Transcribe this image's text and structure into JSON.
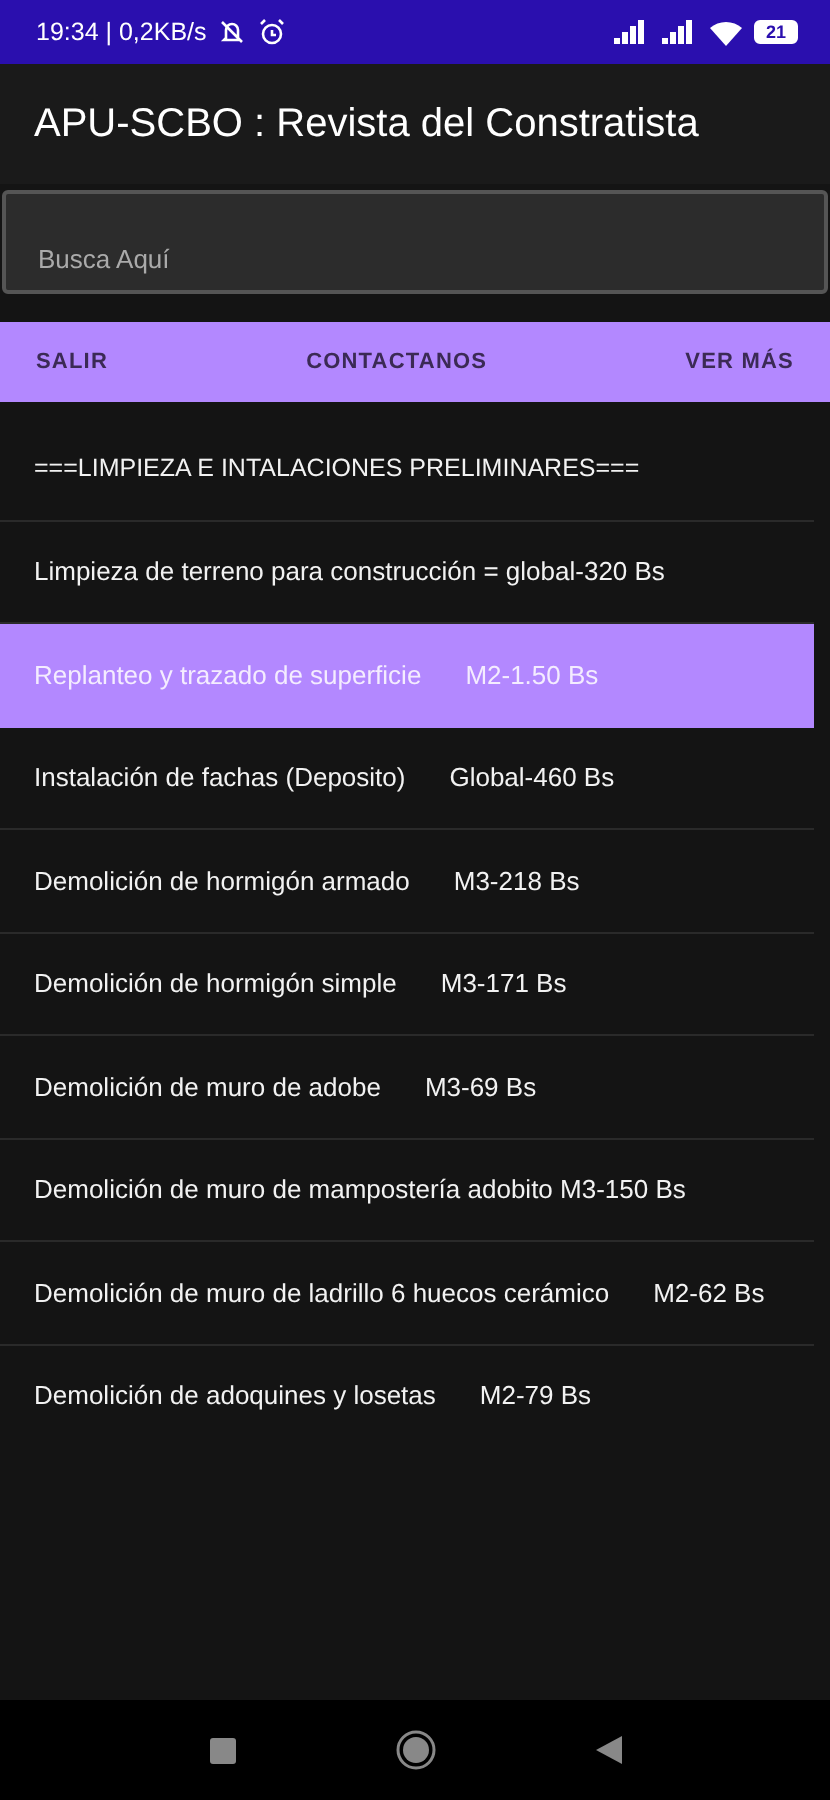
{
  "status_bar": {
    "time": "19:34 | 0,2KB/s",
    "battery": "21"
  },
  "app_bar": {
    "title": "APU-SCBO : Revista del Constratista"
  },
  "search": {
    "placeholder": "Busca Aquí"
  },
  "buttons": [
    {
      "label": "SALIR"
    },
    {
      "label": "CONTACTANOS"
    },
    {
      "label": "VER MÁS"
    }
  ],
  "list": [
    {
      "kind": "header",
      "name": "===LIMPIEZA E INTALACIONES PRELIMINARES===",
      "selected": false
    },
    {
      "kind": "item",
      "name": "Limpieza de terreno para construcción = global-320 Bs",
      "selected": false
    },
    {
      "kind": "item",
      "name": "Replanteo y trazado de superficie",
      "price": "M2-1.50 Bs",
      "selected": true
    },
    {
      "kind": "item",
      "name": "Instalación de fachas (Deposito)",
      "price": "Global-460 Bs",
      "selected": false
    },
    {
      "kind": "item",
      "name": "Demolición de hormigón armado",
      "price": "M3-218 Bs",
      "selected": false
    },
    {
      "kind": "item",
      "name": "Demolición de hormigón simple",
      "price": "M3-171 Bs",
      "selected": false
    },
    {
      "kind": "item",
      "name": "Demolición de muro de adobe",
      "price": "M3-69 Bs",
      "selected": false
    },
    {
      "kind": "item",
      "name": "Demolición de muro de mampostería adobito M3-150 Bs",
      "selected": false
    },
    {
      "kind": "item",
      "name": "Demolición de muro de ladrillo 6 huecos cerámico",
      "price": "M2-62 Bs",
      "selected": false
    },
    {
      "kind": "item",
      "name": "Demolición de adoquines y losetas",
      "price": "M2-79 Bs",
      "selected": false
    }
  ]
}
